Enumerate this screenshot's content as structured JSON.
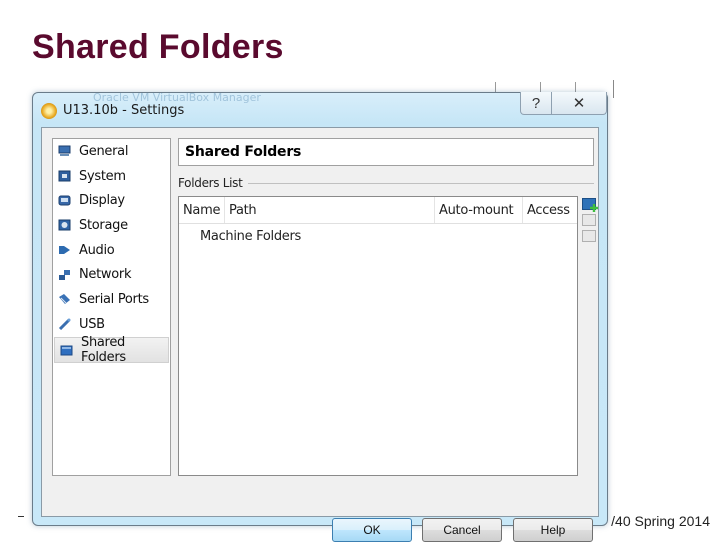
{
  "slide": {
    "title": "Shared Folders",
    "footer_visible": "/40 Spring 2014"
  },
  "background_window": {
    "title_ghost": "Oracle VM VirtualBox Manager"
  },
  "dialog": {
    "title": "U13.10b - Settings",
    "caption_buttons": {
      "help": "?",
      "close": "✕"
    },
    "nav": [
      {
        "label": "General",
        "icon": "monitor-icon",
        "selected": false
      },
      {
        "label": "System",
        "icon": "chip-icon",
        "selected": false
      },
      {
        "label": "Display",
        "icon": "display-icon",
        "selected": false
      },
      {
        "label": "Storage",
        "icon": "disk-icon",
        "selected": false
      },
      {
        "label": "Audio",
        "icon": "speaker-icon",
        "selected": false
      },
      {
        "label": "Network",
        "icon": "network-icon",
        "selected": false
      },
      {
        "label": "Serial Ports",
        "icon": "serial-port-icon",
        "selected": false
      },
      {
        "label": "USB",
        "icon": "usb-icon",
        "selected": false
      },
      {
        "label": "Shared Folders",
        "icon": "folder-icon",
        "selected": true
      }
    ],
    "page_header": "Shared Folders",
    "folders_list": {
      "group_label": "Folders List",
      "columns": [
        "Name",
        "Path",
        "Auto-mount",
        "Access"
      ],
      "rows": [
        {
          "name": "Machine Folders"
        }
      ],
      "tools": [
        "add-shared-folder-icon",
        "edit-shared-folder-icon",
        "remove-shared-folder-icon"
      ]
    },
    "buttons": {
      "ok": "OK",
      "cancel": "Cancel",
      "help": "Help"
    }
  }
}
